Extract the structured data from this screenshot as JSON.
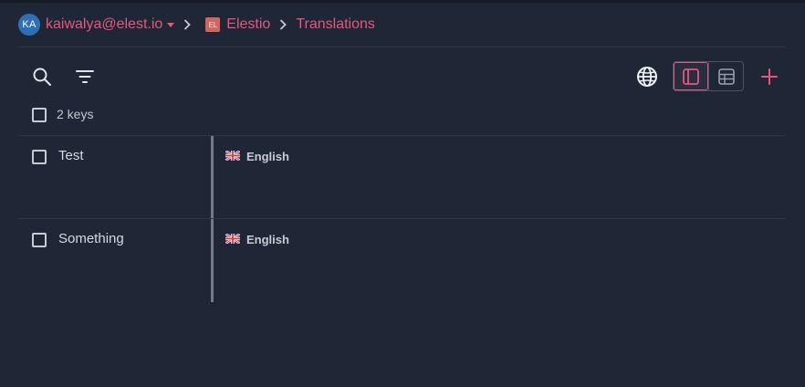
{
  "breadcrumb": {
    "avatar_initials": "KA",
    "user_email": "kaiwalya@elest.io",
    "org_badge": "EL",
    "org_name": "Elestio",
    "project_name": "Translations"
  },
  "toolbar": {
    "search_icon": "search-icon",
    "filter_icon": "filter-icon",
    "language_icon": "globe-icon",
    "view_options": [
      "list-view-icon",
      "table-view-icon"
    ],
    "active_view": "list-view-icon",
    "add_icon": "plus-icon"
  },
  "list": {
    "select_all_checked": false,
    "keys_count_label": "2 keys",
    "rows": [
      {
        "key": "Test",
        "checked": false,
        "language": "English",
        "flag_icon": "uk-flag-icon"
      },
      {
        "key": "Something",
        "checked": false,
        "language": "English",
        "flag_icon": "uk-flag-icon"
      }
    ]
  },
  "colors": {
    "background": "#1f2636",
    "accent": "#e6567f",
    "avatar": "#2f6fb6",
    "org_badge": "#d0665d",
    "divider": "#2e3647"
  }
}
